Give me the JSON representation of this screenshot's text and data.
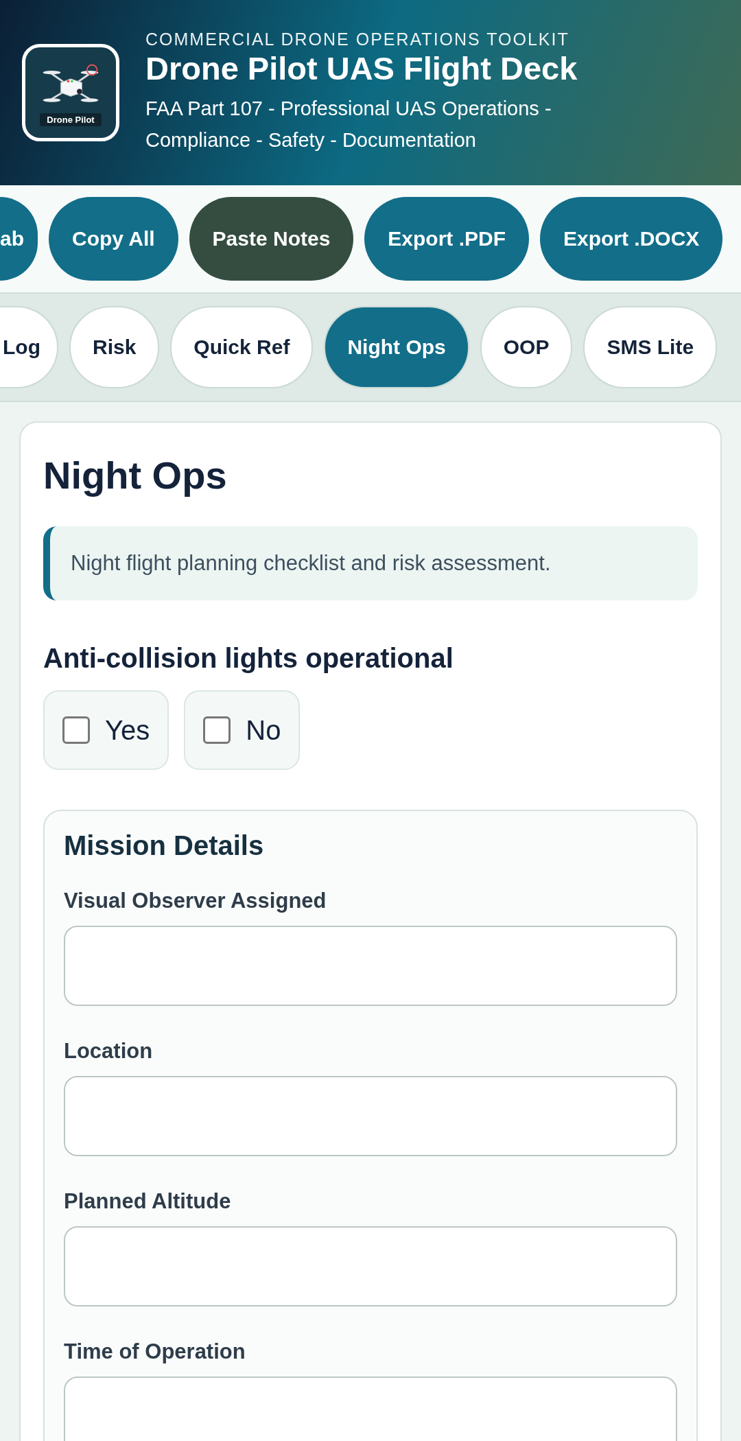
{
  "header": {
    "logo_label": "Drone Pilot",
    "kicker": "COMMERCIAL DRONE OPERATIONS TOOLKIT",
    "title": "Drone Pilot UAS Flight Deck",
    "subtitle": "FAA Part 107 - Professional UAS Operations - Compliance - Safety - Documentation"
  },
  "actions": [
    {
      "label": "ab",
      "kind": "primary",
      "cut": true
    },
    {
      "label": "Copy All",
      "kind": "primary",
      "cut": false
    },
    {
      "label": "Paste Notes",
      "kind": "dark",
      "cut": false
    },
    {
      "label": "Export .PDF",
      "kind": "primary",
      "cut": false
    },
    {
      "label": "Export .DOCX",
      "kind": "primary",
      "cut": false
    }
  ],
  "tabs": [
    {
      "label": "Log",
      "selected": false,
      "cut": true
    },
    {
      "label": "Risk",
      "selected": false,
      "cut": false
    },
    {
      "label": "Quick Ref",
      "selected": false,
      "cut": false
    },
    {
      "label": "Night Ops",
      "selected": true,
      "cut": false
    },
    {
      "label": "OOP",
      "selected": false,
      "cut": false
    },
    {
      "label": "SMS Lite",
      "selected": false,
      "cut": false
    }
  ],
  "panel": {
    "title": "Night Ops",
    "note": "Night flight planning checklist and risk assessment.",
    "question": {
      "label": "Anti-collision lights operational",
      "options": [
        {
          "label": "Yes",
          "checked": false
        },
        {
          "label": "No",
          "checked": false
        }
      ]
    },
    "section": {
      "title": "Mission Details",
      "fields": [
        {
          "label": "Visual Observer Assigned"
        },
        {
          "label": "Location"
        },
        {
          "label": "Planned Altitude"
        },
        {
          "label": "Time of Operation"
        }
      ]
    }
  }
}
